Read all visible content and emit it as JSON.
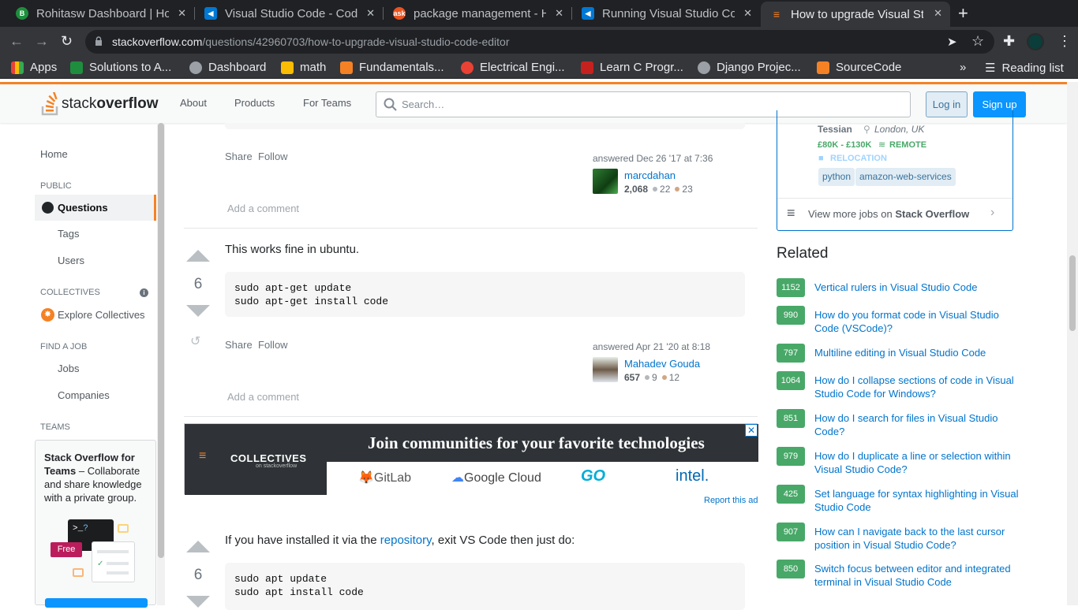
{
  "browser": {
    "tabs": [
      {
        "title": "Rohitasw Dashboard | Ho",
        "favicon": "green-circle-b",
        "color": "#1e8e3e"
      },
      {
        "title": "Visual Studio Code - Code",
        "favicon": "vscode-icon",
        "color": "#0078d4"
      },
      {
        "title": "package management - H",
        "favicon": "askubuntu-icon",
        "color": "#e95420"
      },
      {
        "title": "Running Visual Studio Co",
        "favicon": "vscode-icon",
        "color": "#0078d4"
      },
      {
        "title": "How to upgrade Visual St",
        "favicon": "stackoverflow-icon",
        "color": "#f48225"
      }
    ],
    "url_host": "stackoverflow.com",
    "url_path": "/questions/42960703/how-to-upgrade-visual-studio-code-editor",
    "bookmarks": [
      "Apps",
      "Solutions to A...",
      "Dashboard",
      "math",
      "Fundamentals...",
      "Electrical Engi...",
      "Learn C Progr...",
      "Django Projec...",
      "SourceCode"
    ],
    "reading_list": "Reading list"
  },
  "header": {
    "logo_a": "stack",
    "logo_b": "overflow",
    "nav": [
      "About",
      "Products",
      "For Teams"
    ],
    "search_placeholder": "Search…",
    "login": "Log in",
    "signup": "Sign up"
  },
  "leftnav": {
    "home": "Home",
    "public": "PUBLIC",
    "questions": "Questions",
    "tags": "Tags",
    "users": "Users",
    "collectives": "COLLECTIVES",
    "explore": "Explore Collectives",
    "find_job": "FIND A JOB",
    "jobs": "Jobs",
    "companies": "Companies",
    "teams": "TEAMS",
    "teams_title": "Stack Overflow for Teams",
    "teams_desc": " – Collaborate and share knowledge with a private group.",
    "free": "Free"
  },
  "answers": [
    {
      "share": "Share",
      "follow": "Follow",
      "answered": "answered Dec 26 '17 at 7:36",
      "user": "marcdahan",
      "rep": "2,068",
      "silver": "22",
      "bronze": "23",
      "add_comment": "Add a comment"
    },
    {
      "votes": "6",
      "text": "This works fine in ubuntu.",
      "code": "sudo apt-get update\nsudo apt-get install code",
      "share": "Share",
      "follow": "Follow",
      "answered": "answered Apr 21 '20 at 8:18",
      "user": "Mahadev Gouda",
      "rep": "657",
      "silver": "9",
      "bronze": "12",
      "add_comment": "Add a comment"
    },
    {
      "votes": "6",
      "text_a": "If you have installed it via the ",
      "link": "repository",
      "text_b": ", exit VS Code then just do:",
      "code": "sudo apt update\nsudo apt install code"
    }
  ],
  "ad": {
    "collectives": "COLLECTIVES",
    "collectives_sub": "on stackoverflow",
    "title": "Join communities for your favorite technologies",
    "logos": [
      "GitLab",
      "Google Cloud",
      "GO",
      "intel."
    ],
    "report": "Report this ad"
  },
  "job": {
    "company": "Tessian",
    "location": "London, UK",
    "salary": "£80K - £130K",
    "remote": "REMOTE",
    "relocation": "RELOCATION",
    "tags": [
      "python",
      "amazon-web-services"
    ],
    "more_a": "View more jobs on ",
    "more_b": "Stack Overflow"
  },
  "related": {
    "title": "Related",
    "items": [
      {
        "count": "1152",
        "title": "Vertical rulers in Visual Studio Code"
      },
      {
        "count": "990",
        "title": "How do you format code in Visual Studio Code (VSCode)?"
      },
      {
        "count": "797",
        "title": "Multiline editing in Visual Studio Code"
      },
      {
        "count": "1064",
        "title": "How do I collapse sections of code in Visual Studio Code for Windows?"
      },
      {
        "count": "851",
        "title": "How do I search for files in Visual Studio Code?"
      },
      {
        "count": "979",
        "title": "How do I duplicate a line or selection within Visual Studio Code?"
      },
      {
        "count": "425",
        "title": "Set language for syntax highlighting in Visual Studio Code"
      },
      {
        "count": "907",
        "title": "How can I navigate back to the last cursor position in Visual Studio Code?"
      },
      {
        "count": "850",
        "title": "Switch focus between editor and integrated terminal in Visual Studio Code"
      }
    ]
  },
  "colors": {
    "accent": "#f48225",
    "link": "#0074cc",
    "vote_green": "#48a868"
  }
}
